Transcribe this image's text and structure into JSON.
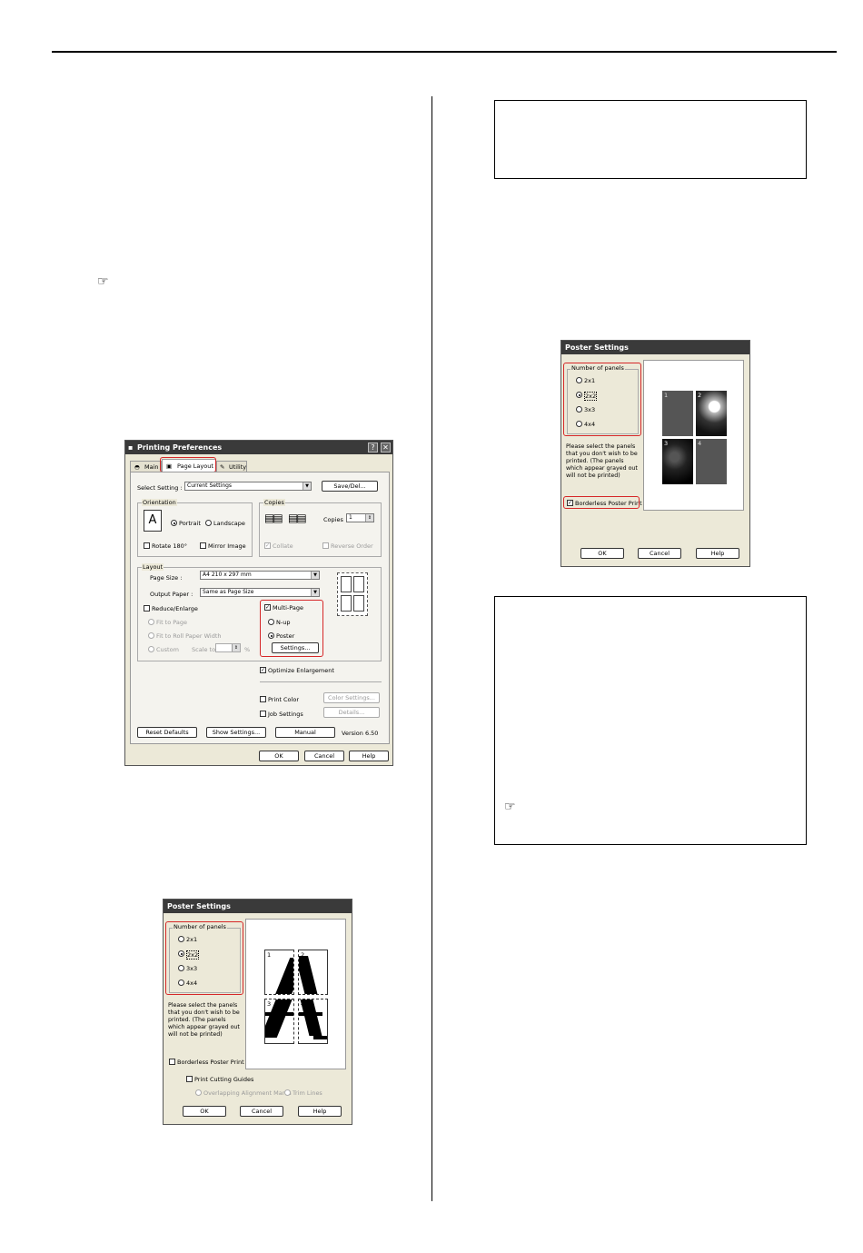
{
  "page": {
    "layout": "two-column manual page with dialog screenshots"
  },
  "printing_preferences": {
    "title": "Printing Preferences",
    "help_btn": "?",
    "close_btn": "✕",
    "tabs": [
      "Main",
      "Page Layout",
      "Utility"
    ],
    "select_setting_label": "Select Setting :",
    "select_setting_value": "Current Settings",
    "save_del": "Save/Del...",
    "orientation_title": "Orientation",
    "portrait": "Portrait",
    "landscape": "Landscape",
    "rotate": "Rotate 180°",
    "mirror": "Mirror Image",
    "copies_title": "Copies",
    "copies_label": "Copies",
    "copies_value": "1",
    "collate": "Collate",
    "reverse_order": "Reverse Order",
    "layout_title": "Layout",
    "page_size_label": "Page Size :",
    "page_size_value": "A4 210 x 297 mm",
    "output_paper_label": "Output Paper :",
    "output_paper_value": "Same as Page Size",
    "reduce_enlarge": "Reduce/Enlarge",
    "fit_to_page": "Fit to Page",
    "fit_roll": "Fit to Roll Paper Width",
    "custom": "Custom",
    "scale_to": "Scale to",
    "scale_unit": "%",
    "multi_page": "Multi-Page",
    "n_up": "N-up",
    "poster": "Poster",
    "settings_btn": "Settings...",
    "optimize": "Optimize Enlargement",
    "print_color": "Print Color",
    "color_settings": "Color Settings...",
    "job_settings": "Job Settings",
    "details": "Details...",
    "reset_defaults": "Reset Defaults",
    "show_settings": "Show Settings...",
    "manual": "Manual",
    "version": "Version 6.50",
    "ok": "OK",
    "cancel": "Cancel",
    "help": "Help"
  },
  "poster_a": {
    "title": "Poster Settings",
    "group": "Number of panels",
    "options": [
      "2x1",
      "2x2",
      "3x3",
      "4x4"
    ],
    "note": "Please select the panels that you don't wish to be printed. (The panels which appear grayed out will not be printed)",
    "borderless": "Borderless Poster Print",
    "cutting_guides": "Print Cutting Guides",
    "overlap": "Overlapping Alignment Marks",
    "trim": "Trim Lines",
    "panel_numbers": [
      "1",
      "2",
      "3",
      "4"
    ],
    "ok": "OK",
    "cancel": "Cancel",
    "help": "Help"
  },
  "poster_b": {
    "title": "Poster Settings",
    "group": "Number of panels",
    "options": [
      "2x1",
      "2x2",
      "3x3",
      "4x4"
    ],
    "note": "Please select the panels that you don't wish to be printed. (The panels which appear grayed out will not be printed)",
    "borderless": "Borderless Poster Print",
    "panel_numbers": [
      "1",
      "2",
      "3",
      "4"
    ],
    "ok": "OK",
    "cancel": "Cancel",
    "help": "Help"
  },
  "icons": {
    "hand": "☞"
  }
}
